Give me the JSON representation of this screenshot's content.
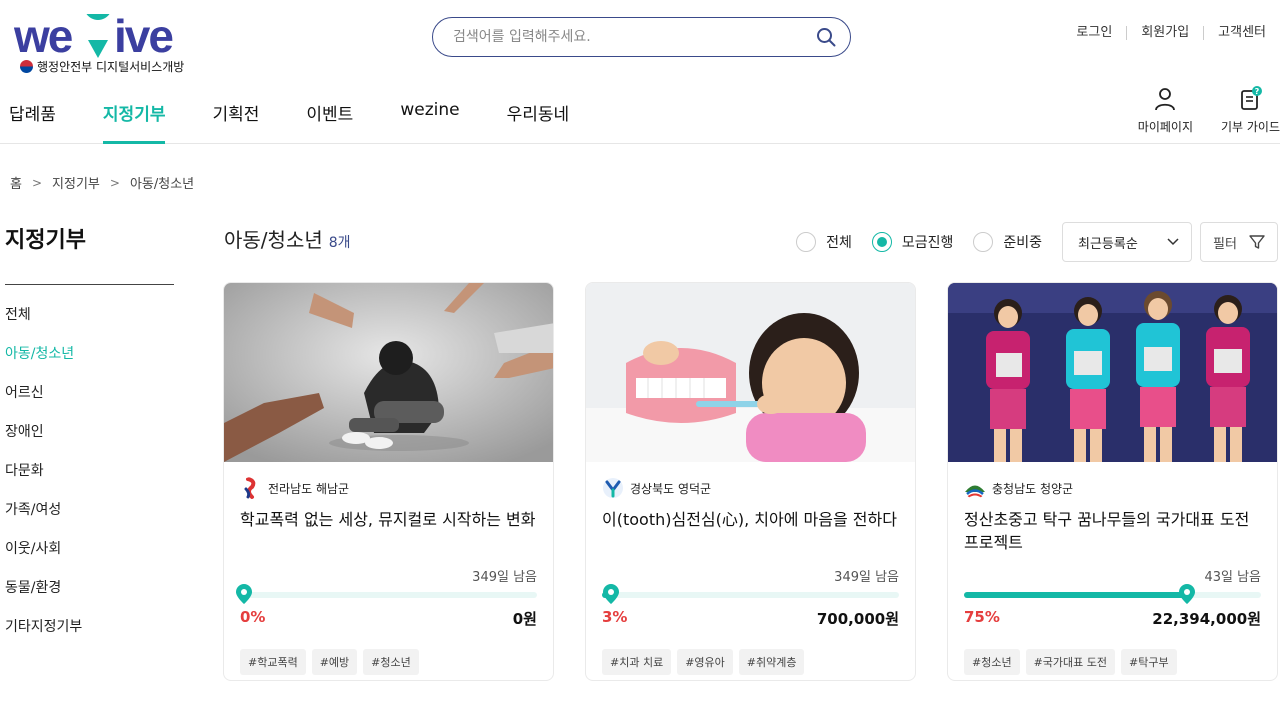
{
  "brand": {
    "logo_text": "weGive",
    "subtitle": "행정안전부 디지털서비스개방"
  },
  "search": {
    "placeholder": "검색어를 입력해주세요."
  },
  "util_links": [
    "로그인",
    "회원가입",
    "고객센터"
  ],
  "gnb": [
    "답례품",
    "지정기부",
    "기획전",
    "이벤트",
    "wezine",
    "우리동네"
  ],
  "side_icons": {
    "mypage": "마이페이지",
    "guide": "기부 가이드",
    "guide_badge": "?"
  },
  "breadcrumb": [
    "홈",
    "지정기부",
    "아동/청소년"
  ],
  "lnb": {
    "title": "지정기부",
    "items": [
      "전체",
      "아동/청소년",
      "어르신",
      "장애인",
      "다문화",
      "가족/여성",
      "이웃/사회",
      "동물/환경",
      "기타지정기부"
    ]
  },
  "content": {
    "title": "아동/청소년",
    "count": "8개"
  },
  "filters": {
    "radios": [
      "전체",
      "모금진행",
      "준비중"
    ],
    "selected_radio": "모금진행",
    "sort": "최근등록순",
    "filter_label": "필터"
  },
  "colors": {
    "accent": "#14b8a6",
    "navy": "#3a4a8a",
    "percent": "#e53e3e"
  },
  "cards": [
    {
      "org": "전라남도 해남군",
      "title": "학교폭력 없는 세상, 뮤지컬로 시작하는 변화",
      "days": "349일 남음",
      "percent_label": "0%",
      "progress": 0,
      "amount": "0원",
      "tags": [
        "#학교폭력",
        "#예방",
        "#청소년"
      ]
    },
    {
      "org": "경상북도 영덕군",
      "title": "이(tooth)심전심(心), 치아에 마음을 전하다",
      "days": "349일 남음",
      "percent_label": "3%",
      "progress": 3,
      "amount": "700,000원",
      "tags": [
        "#치과 치료",
        "#영유아",
        "#취약계층"
      ]
    },
    {
      "org": "충청남도 청양군",
      "title": "정산초중고 탁구 꿈나무들의 국가대표 도전 프로젝트",
      "days": "43일 남음",
      "percent_label": "75%",
      "progress": 75,
      "amount": "22,394,000원",
      "tags": [
        "#청소년",
        "#국가대표 도전",
        "#탁구부"
      ]
    }
  ]
}
